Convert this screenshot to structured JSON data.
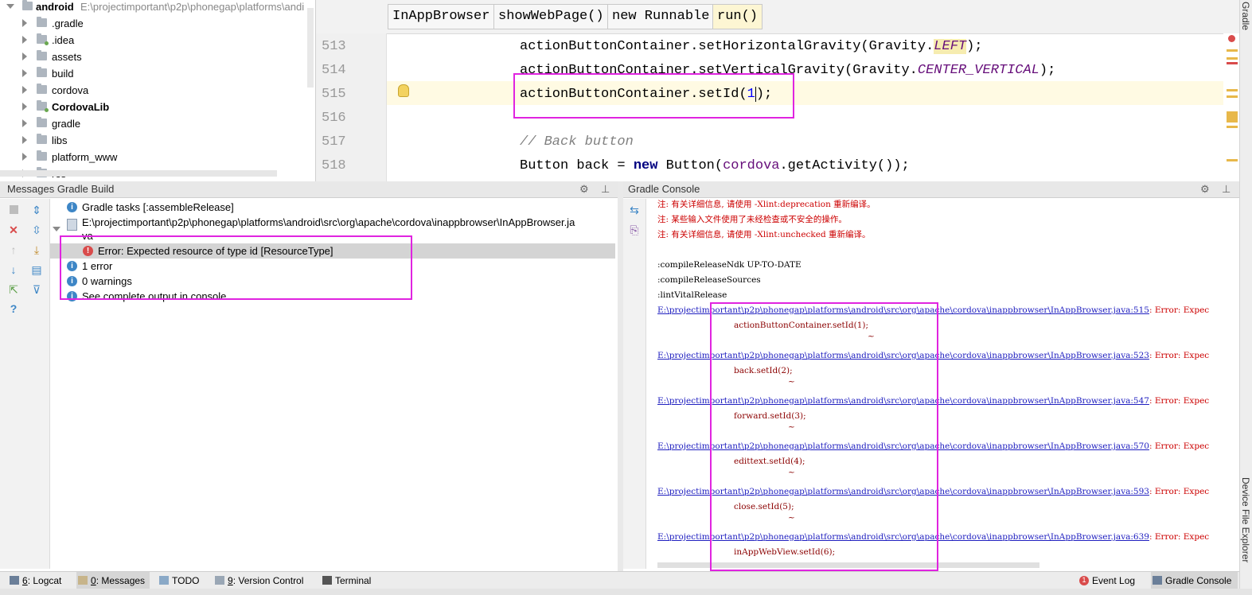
{
  "project_tree": {
    "root": {
      "label": "android",
      "path": "E:\\projectimportant\\p2p\\phonegap\\platforms\\andi"
    },
    "items": [
      {
        "label": ".gradle",
        "bold": false,
        "module": false
      },
      {
        "label": ".idea",
        "bold": false,
        "module": true
      },
      {
        "label": "assets",
        "bold": false,
        "module": false
      },
      {
        "label": "build",
        "bold": false,
        "module": false
      },
      {
        "label": "cordova",
        "bold": false,
        "module": false
      },
      {
        "label": "CordovaLib",
        "bold": true,
        "module": true
      },
      {
        "label": "gradle",
        "bold": false,
        "module": false
      },
      {
        "label": "libs",
        "bold": false,
        "module": false
      },
      {
        "label": "platform_www",
        "bold": false,
        "module": false
      },
      {
        "label": "res",
        "bold": false,
        "module": false
      }
    ]
  },
  "editor": {
    "breadcrumbs": [
      "InAppBrowser",
      "showWebPage()",
      "new Runnable",
      "run()"
    ],
    "lines": [
      {
        "no": "513"
      },
      {
        "no": "514"
      },
      {
        "no": "515"
      },
      {
        "no": "516"
      },
      {
        "no": "517"
      },
      {
        "no": "518"
      }
    ],
    "code": {
      "l513_a": "actionButtonContainer.setHorizontalGravity(Gravity.",
      "l513_c": "LEFT",
      "l513_b": ");",
      "l514_a": "actionButtonContainer.setVerticalGravity(Gravity.",
      "l514_c": "CENTER_VERTICAL",
      "l514_b": ");",
      "l515_a": "actionButtonContainer.setId(",
      "l515_n": "1",
      "l515_b": ");",
      "l517": "// Back button",
      "l518_a": "Button back = ",
      "l518_kw": "new",
      "l518_b": " Button(",
      "l518_f": "cordova",
      "l518_c": ".getActivity());"
    }
  },
  "messages_panel": {
    "title": "Messages Gradle Build",
    "rows": [
      "Gradle tasks [:assembleRelease]",
      "E:\\projectimportant\\p2p\\phonegap\\platforms\\android\\src\\org\\apache\\cordova\\inappbrowser\\InAppBrowser.ja",
      "va",
      "Error: Expected resource of type id [ResourceType]",
      "1 error",
      "0 warnings",
      "See complete output in console"
    ]
  },
  "console_panel": {
    "title": "Gradle Console",
    "notes": [
      "注: 有关详细信息, 请使用 -Xlint:deprecation 重新编译。",
      "注: 某些输入文件使用了未经检查或不安全的操作。",
      "注: 有关详细信息, 请使用 -Xlint:unchecked 重新编译。"
    ],
    "tasks": [
      ":compileReleaseNdk UP-TO-DATE",
      ":compileReleaseSources",
      ":lintVitalRelease"
    ],
    "errors": [
      {
        "link": "E:\\projectimportant\\p2p\\phonegap\\platforms\\android\\src\\org\\apache\\cordova\\inappbrowser\\InAppBrowser.java:515",
        "msg": ": Error: Expec",
        "code": "actionButtonContainer.setId(1);",
        "caret": "~"
      },
      {
        "link": "E:\\projectimportant\\p2p\\phonegap\\platforms\\android\\src\\org\\apache\\cordova\\inappbrowser\\InAppBrowser.java:523",
        "msg": ": Error: Expec",
        "code": "back.setId(2);",
        "caret": "~"
      },
      {
        "link": "E:\\projectimportant\\p2p\\phonegap\\platforms\\android\\src\\org\\apache\\cordova\\inappbrowser\\InAppBrowser.java:547",
        "msg": ": Error: Expec",
        "code": "forward.setId(3);",
        "caret": "~"
      },
      {
        "link": "E:\\projectimportant\\p2p\\phonegap\\platforms\\android\\src\\org\\apache\\cordova\\inappbrowser\\InAppBrowser.java:570",
        "msg": ": Error: Expec",
        "code": "edittext.setId(4);",
        "caret": "~"
      },
      {
        "link": "E:\\projectimportant\\p2p\\phonegap\\platforms\\android\\src\\org\\apache\\cordova\\inappbrowser\\InAppBrowser.java:593",
        "msg": ": Error: Expec",
        "code": "close.setId(5);",
        "caret": "~"
      },
      {
        "link": "E:\\projectimportant\\p2p\\phonegap\\platforms\\android\\src\\org\\apache\\cordova\\inappbrowser\\InAppBrowser.java:639",
        "msg": ": Error: Expec",
        "code": "inAppWebView.setId(6);",
        "caret": "~"
      }
    ]
  },
  "side_strip": {
    "top": "Gradle",
    "bottom": "Device File Explorer"
  },
  "tool_tabs": [
    {
      "mnemonic": "6",
      "label": ": Logcat"
    },
    {
      "mnemonic": "0",
      "label": ": Messages"
    },
    {
      "mnemonic": "",
      "label": "TODO"
    },
    {
      "mnemonic": "9",
      "label": ": Version Control"
    },
    {
      "mnemonic": "",
      "label": "Terminal"
    }
  ],
  "right_tabs": [
    {
      "label": "Event Log",
      "badge": "1"
    },
    {
      "label": "Gradle Console"
    }
  ],
  "colors": {
    "highlight": "#e024e0",
    "error_red": "#cc0000",
    "link_blue": "#2020c0"
  },
  "icons": [
    "chevron-right-icon",
    "folder-icon",
    "bulb-icon",
    "gear-icon",
    "pin-icon",
    "info-icon",
    "error-icon",
    "stop-icon",
    "close-icon",
    "arrow-up-icon",
    "arrow-down-icon",
    "filter-icon",
    "help-icon",
    "expand-icon",
    "collapse-icon",
    "export-icon"
  ]
}
